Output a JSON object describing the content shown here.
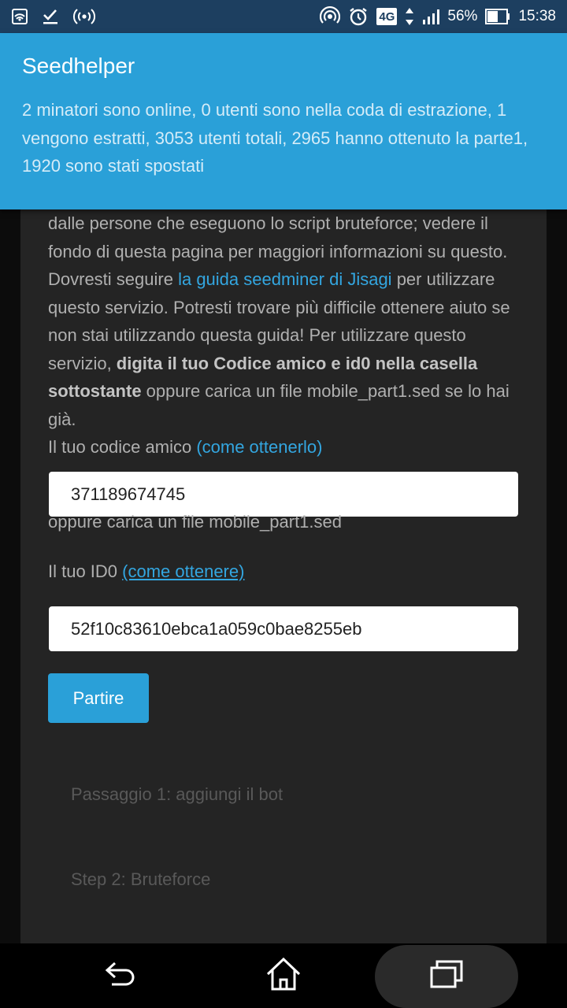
{
  "status_bar": {
    "battery": "56%",
    "time": "15:38",
    "network": "4G",
    "icons": [
      "nfc-icon",
      "check-download-icon",
      "hotspot-icon",
      "wifi-signal-icon",
      "alarm-icon",
      "signal-icon",
      "battery-icon"
    ]
  },
  "header": {
    "title": "Seedhelper",
    "stats": "2 minatori sono online, 0 utenti sono nella coda di estrazione, 1 vengono estratti, 3053 utenti totali, 2965 hanno ottenuto la parte1, 1920 sono stati spostati"
  },
  "intro": {
    "text_1": "dalle persone che eseguono lo script bruteforce; vedere il fondo di questa pagina per maggiori informazioni su questo. Dovresti seguire ",
    "guide_link": "la guida seedminer di Jisagi",
    "text_2": " per utilizzare questo servizio. Potresti trovare più difficile ottenere aiuto se non stai utilizzando questa guida! Per utilizzare questo servizio, ",
    "bold": "digita il tuo Codice amico e id0 nella casella sottostante",
    "text_3": " oppure carica un file mobile_part1.sed se lo hai già."
  },
  "friend_code": {
    "label": "Il tuo codice amico ",
    "help_link": "(come ottenerlo)",
    "value": "371189674745",
    "upload_link": "oppure carica un file mobile_part1.sed"
  },
  "id0": {
    "label": "Il tuo ID0 ",
    "help_link": "(come ottenere)",
    "value": "52f10c83610ebca1a059c0bae8255eb"
  },
  "submit": {
    "label": "Partire"
  },
  "steps": [
    {
      "label": "Passaggio 1: aggiungi il bot"
    },
    {
      "label": "Step 2: Bruteforce"
    }
  ],
  "colors": {
    "accent": "#2aa0d8",
    "status_bar": "#1d3f60",
    "card": "#242424",
    "link": "#33a6e0"
  }
}
